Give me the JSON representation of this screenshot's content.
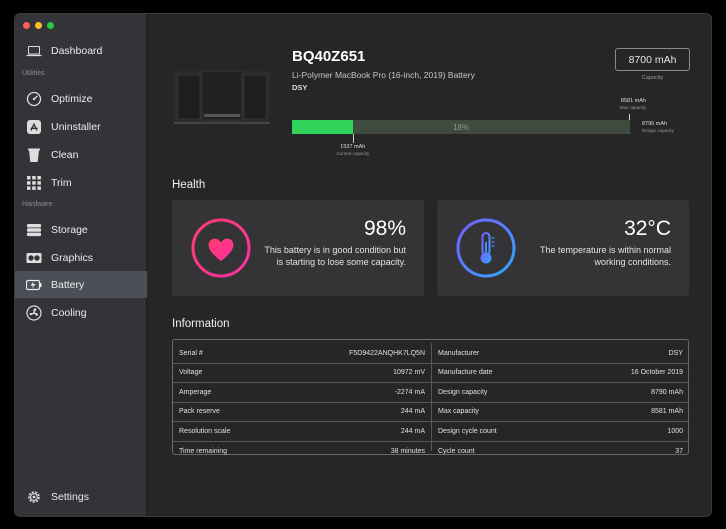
{
  "sidebar": {
    "sections": {
      "utilities": "Utilities",
      "hardware": "Hardware"
    },
    "items": [
      {
        "label": "Dashboard",
        "icon": "laptop-icon"
      },
      {
        "label": "Optimize",
        "icon": "gauge-icon"
      },
      {
        "label": "Uninstaller",
        "icon": "app-store-icon"
      },
      {
        "label": "Clean",
        "icon": "trash-icon"
      },
      {
        "label": "Trim",
        "icon": "grid-icon"
      },
      {
        "label": "Storage",
        "icon": "drive-icon"
      },
      {
        "label": "Graphics",
        "icon": "gpu-icon"
      },
      {
        "label": "Battery",
        "icon": "battery-icon"
      },
      {
        "label": "Cooling",
        "icon": "fan-icon"
      }
    ],
    "settings": "Settings",
    "active": "Battery"
  },
  "battery": {
    "model": "BQ40Z651",
    "description": "Li-Polymer MacBook Pro (16-inch, 2019) Battery",
    "maker": "DSY",
    "capacity_value": "8700 mAh",
    "capacity_label": "Capacity",
    "charge_fraction": 0.18,
    "charge_pct": "18%",
    "current_value": "1537 mAh",
    "current_label": "Current capacity",
    "max_value": "8581 mAh",
    "max_label": "Max capacity",
    "design_value": "8790 mAh",
    "design_label": "Design capacity"
  },
  "health": {
    "heading": "Health",
    "battery": {
      "value": "98%",
      "message": "This battery is in good condition but is starting to lose some capacity."
    },
    "temperature": {
      "value": "32°C",
      "message": "The temperature is within normal working conditions."
    }
  },
  "information": {
    "heading": "Information",
    "left": [
      {
        "label": "Serial #",
        "value": "F5D9422ANQHK7LQ5N"
      },
      {
        "label": "Voltage",
        "value": "10972 mV"
      },
      {
        "label": "Amperage",
        "value": "-2274 mA"
      },
      {
        "label": "Pack reserve",
        "value": "244 mA"
      },
      {
        "label": "Resolution scale",
        "value": "244 mA"
      },
      {
        "label": "Time remaining",
        "value": "38 minutes"
      }
    ],
    "right": [
      {
        "label": "Manufacturer",
        "value": "DSY"
      },
      {
        "label": "Manufacture date",
        "value": "16 October 2019"
      },
      {
        "label": "Design capacity",
        "value": "8790 mAh"
      },
      {
        "label": "Max capacity",
        "value": "8581 mAh"
      },
      {
        "label": "Design cycle count",
        "value": "1000"
      },
      {
        "label": "Cycle count",
        "value": "37"
      }
    ]
  },
  "colors": {
    "accent_green": "#31d45a",
    "heart_pink": "#ff3d84",
    "thermo_blue": "#4a86ff"
  }
}
